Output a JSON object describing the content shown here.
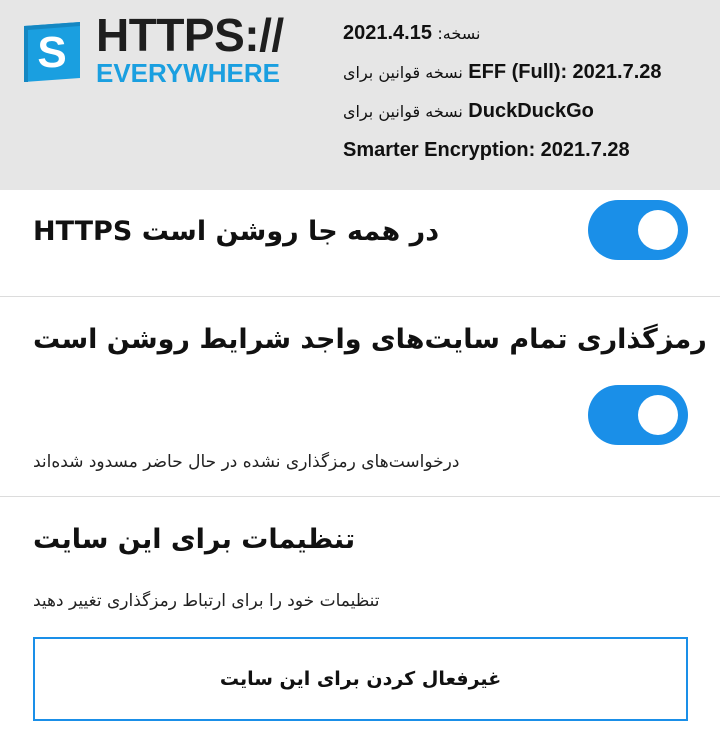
{
  "colors": {
    "accent": "#1a8fe8",
    "header_bg": "#e6e6e6",
    "logo_blue": "#1a9fe0"
  },
  "logo": {
    "letter": "S",
    "line1": "HTTPS://",
    "line2": "EVERYWHERE"
  },
  "info": {
    "version_label": "نسخه:",
    "version_value": "2021.4.15",
    "eff_prefix": "نسخه قوانین برای",
    "eff_name": "EFF (Full):",
    "eff_value": "2021.7.28",
    "ddg_prefix": "نسخه قوانین برای",
    "ddg_name": "DuckDuckGo",
    "smarter_label": "Smarter Encryption:",
    "smarter_value": "2021.7.28"
  },
  "settings": {
    "https_everywhere": {
      "label": "در همه جا روشن است HTTPS",
      "enabled": true
    },
    "encrypt_all": {
      "label": "رمزگذاری تمام سایت‌های واجد شرایط روشن است",
      "description": "درخواست‌های رمزگذاری نشده در حال حاضر مسدود شده‌اند",
      "enabled": true
    },
    "site_settings": {
      "title": "تنظیمات برای این سایت",
      "description": "تنظیمات خود را برای ارتباط رمزگذاری تغییر دهید",
      "disable_button": "غیرفعال کردن برای این سایت"
    }
  }
}
